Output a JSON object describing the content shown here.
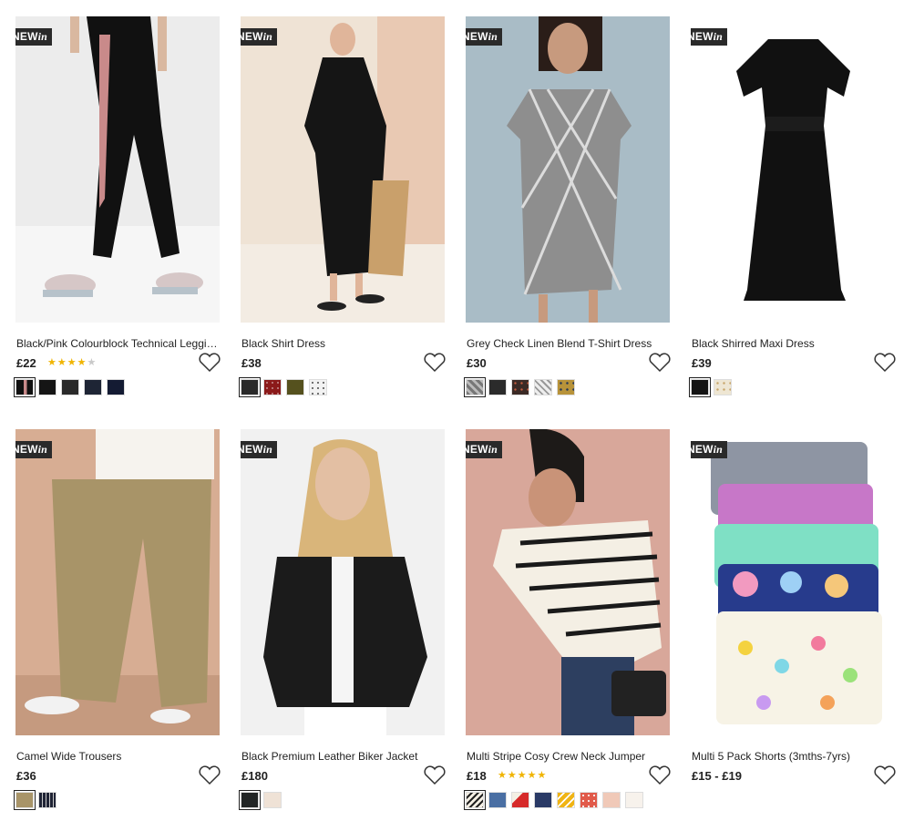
{
  "badge": {
    "new": "NEW",
    "in": "in"
  },
  "products": [
    {
      "title": "Black/Pink Colourblock Technical Leggings",
      "price": "£22",
      "rating": 4,
      "image": "leggings",
      "swatch_colors": [
        "#1a1a1a",
        "#151515",
        "#2a2a2a",
        "#1e2535",
        "#141b33"
      ]
    },
    {
      "title": "Black Shirt Dress",
      "price": "£38",
      "rating": null,
      "image": "shirt-dress",
      "swatch_colors": [
        "#2a2a2a",
        "#8b1a1a",
        "#55511e",
        "#d8d8d8"
      ]
    },
    {
      "title": "Grey Check Linen Blend T-Shirt Dress",
      "price": "£30",
      "rating": null,
      "image": "check-dress",
      "swatch_colors": [
        "#8c8c8c",
        "#2b2b2b",
        "#3b2a25",
        "#bdbdbd",
        "#b8933a"
      ]
    },
    {
      "title": "Black Shirred Maxi Dress",
      "price": "£39",
      "rating": null,
      "image": "maxi-dress",
      "swatch_colors": [
        "#141414",
        "#eee6d3"
      ]
    },
    {
      "title": "Camel Wide Trousers",
      "price": "£36",
      "rating": null,
      "image": "trousers",
      "swatch_colors": [
        "#a89468",
        "#1f2335"
      ]
    },
    {
      "title": "Black Premium Leather Biker Jacket",
      "price": "£180",
      "rating": null,
      "image": "biker-jacket",
      "swatch_colors": [
        "#232626",
        "#efe2d6"
      ]
    },
    {
      "title": "Multi Stripe Cosy Crew Neck Jumper",
      "price": "£18",
      "rating": 5,
      "image": "jumper",
      "swatch_colors": [
        "#f4efe4",
        "#4a6fa3",
        "#d62a2a",
        "#2a3a66",
        "#f0b414",
        "#e15a4a",
        "#f0c9b8",
        "#f7f2ec"
      ]
    },
    {
      "title": "Multi 5 Pack Shorts (3mths-7yrs)",
      "price": "£15 - £19",
      "rating": null,
      "image": "shorts",
      "swatch_colors": []
    }
  ]
}
